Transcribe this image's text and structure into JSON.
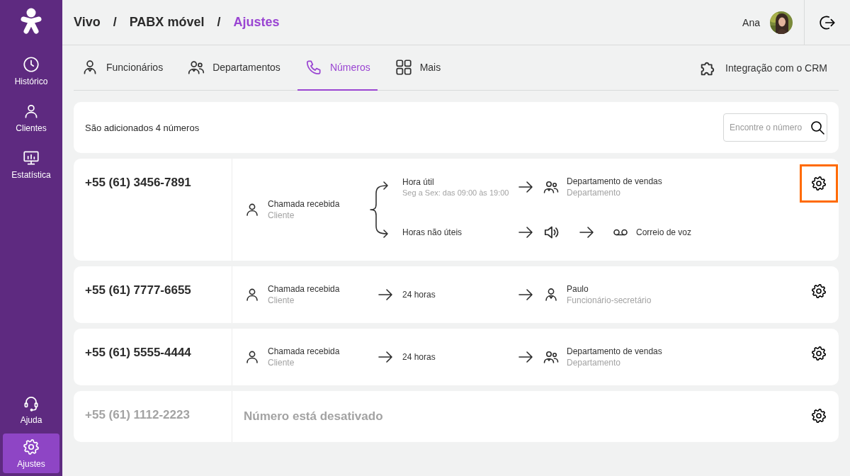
{
  "sidebar": {
    "items": [
      {
        "label": "Histórico",
        "selected": false
      },
      {
        "label": "Clientes",
        "selected": false
      },
      {
        "label": "Estatística",
        "selected": false
      },
      {
        "label": "Ajuda",
        "selected": false
      },
      {
        "label": "Ajustes",
        "selected": true
      }
    ]
  },
  "breadcrumb": {
    "separator": "/",
    "items": [
      {
        "label": "Vivo",
        "current": false
      },
      {
        "label": "PABX móvel",
        "current": false
      },
      {
        "label": "Ajustes",
        "current": true
      }
    ]
  },
  "user": {
    "name": "Ana"
  },
  "tabs": [
    {
      "label": "Funcionários",
      "selected": false
    },
    {
      "label": "Departamentos",
      "selected": false
    },
    {
      "label": "Números",
      "selected": true
    },
    {
      "label": "Mais",
      "selected": false
    }
  ],
  "crm_link": {
    "label": "Integração com o CRM"
  },
  "summary": {
    "text": "São adicionados 4 números",
    "search": {
      "placeholder": "Encontre o número"
    }
  },
  "numbers": [
    {
      "number": "+55 (61) 3456-7891",
      "active": true,
      "highlighted": true,
      "flow": {
        "source": {
          "title": "Chamada recebida",
          "subtitle": "Cliente"
        },
        "branches": [
          {
            "title": "Hora útil",
            "subtitle": "Seg a Sex: das 09:00 às 19:00",
            "steps": [
              {
                "kind": "department",
                "title": "Departamento de vendas",
                "subtitle": "Departamento"
              }
            ]
          },
          {
            "title": "Horas não úteis",
            "steps": [
              {
                "kind": "greeting"
              },
              {
                "kind": "voicemail",
                "title": "Correio de voz"
              }
            ]
          }
        ]
      }
    },
    {
      "number": "+55 (61) 7777-6655",
      "active": true,
      "highlighted": false,
      "flow": {
        "source": {
          "title": "Chamada recebida",
          "subtitle": "Cliente"
        },
        "branches": [
          {
            "title": "24 horas",
            "steps": [
              {
                "kind": "employee",
                "title": "Paulo",
                "subtitle": "Funcionário-secretário"
              }
            ]
          }
        ]
      }
    },
    {
      "number": "+55 (61) 5555-4444",
      "active": true,
      "highlighted": false,
      "flow": {
        "source": {
          "title": "Chamada recebida",
          "subtitle": "Cliente"
        },
        "branches": [
          {
            "title": "24 horas",
            "steps": [
              {
                "kind": "department",
                "title": "Departamento de vendas",
                "subtitle": "Departamento"
              }
            ]
          }
        ]
      }
    },
    {
      "number": "+55 (61) 1112-2223",
      "active": false,
      "highlighted": false,
      "message": "Número está desativado"
    }
  ]
}
